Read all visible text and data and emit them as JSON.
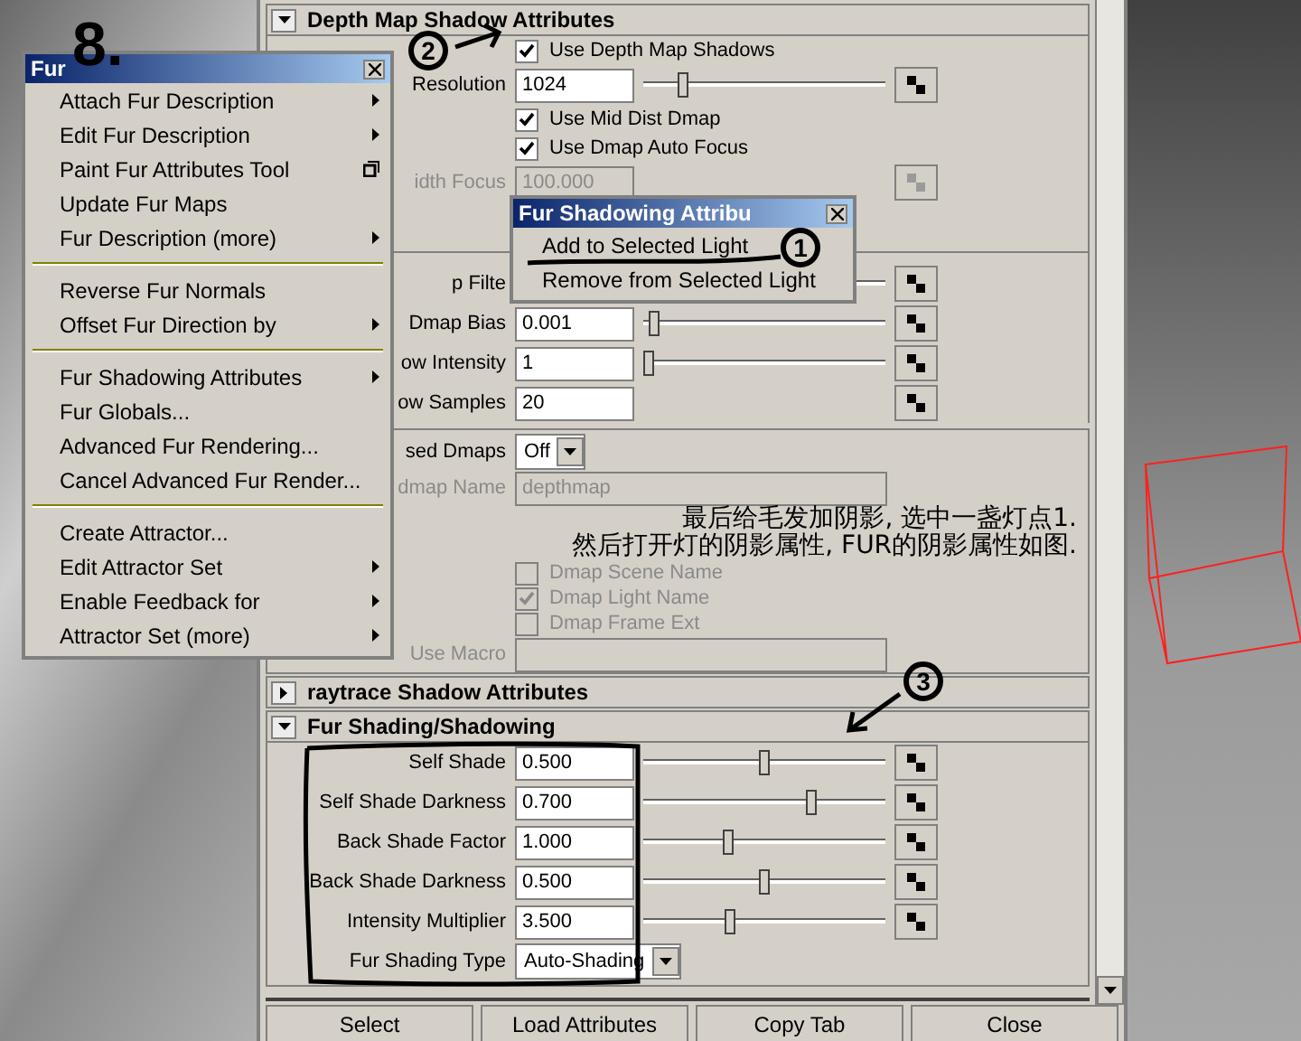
{
  "fur_menu": {
    "title": "Fur",
    "groups": [
      [
        {
          "label": "Attach Fur Description",
          "kind": "submenu"
        },
        {
          "label": "Edit Fur Description",
          "kind": "submenu"
        },
        {
          "label": "Paint Fur Attributes Tool",
          "kind": "option"
        },
        {
          "label": "Update Fur Maps",
          "kind": "plain"
        },
        {
          "label": "Fur Description (more)",
          "kind": "submenu"
        }
      ],
      [
        {
          "label": "Reverse Fur Normals",
          "kind": "plain"
        },
        {
          "label": "Offset Fur Direction by",
          "kind": "submenu"
        }
      ],
      [
        {
          "label": "Fur Shadowing Attributes",
          "kind": "submenu"
        },
        {
          "label": "Fur Globals...",
          "kind": "plain"
        },
        {
          "label": "Advanced Fur Rendering...",
          "kind": "plain"
        },
        {
          "label": "Cancel Advanced Fur Render...",
          "kind": "plain"
        }
      ],
      [
        {
          "label": "Create Attractor...",
          "kind": "plain"
        },
        {
          "label": "Edit Attractor Set",
          "kind": "submenu"
        },
        {
          "label": "Enable Feedback for",
          "kind": "submenu"
        },
        {
          "label": "Attractor Set (more)",
          "kind": "submenu"
        }
      ]
    ]
  },
  "submenu": {
    "title": "Fur Shadowing Attribu",
    "items": [
      "Add to Selected Light",
      "Remove from Selected Light"
    ]
  },
  "depth_section": {
    "title": "Depth Map Shadow Attributes",
    "expanded": true,
    "rows": [
      {
        "kind": "checkbox",
        "label": "Use Depth Map Shadows",
        "checked": true,
        "disabled": false
      },
      {
        "kind": "slider",
        "label": "Resolution",
        "value": "1024",
        "level": 0.15
      },
      {
        "kind": "checkbox",
        "label": "Use Mid Dist Dmap",
        "checked": true,
        "disabled": false
      },
      {
        "kind": "checkbox",
        "label": "Use Dmap Auto Focus",
        "checked": true,
        "disabled": false
      },
      {
        "kind": "field",
        "label": "idth Focus",
        "value": "100.000",
        "disabled": true
      },
      {
        "kind": "gap"
      },
      {
        "kind": "slider",
        "label": "p Filte"
      },
      {
        "kind": "slider",
        "label": "Dmap Bias",
        "value": "0.001",
        "level": 0.02
      },
      {
        "kind": "slider",
        "label": "ow Intensity",
        "value": "1",
        "level": 0.0
      },
      {
        "kind": "field",
        "label": "ow Samples",
        "value": "20"
      }
    ]
  },
  "dmap_section": {
    "rows": [
      {
        "kind": "dropdown",
        "label": "sed Dmaps",
        "value": "Off"
      },
      {
        "kind": "text",
        "label": "dmap Name",
        "value": "depthmap",
        "disabled": true
      },
      {
        "kind": "checkbox",
        "label": "Dmap Scene Name",
        "checked": false,
        "disabled": true
      },
      {
        "kind": "checkbox",
        "label": "Dmap Light Name",
        "checked": true,
        "disabled": true
      },
      {
        "kind": "checkbox",
        "label": "Dmap Frame Ext",
        "checked": false,
        "disabled": true
      },
      {
        "kind": "text",
        "label": "Use Macro",
        "disabled": true
      }
    ]
  },
  "raytrace_section": {
    "title": "raytrace Shadow Attributes",
    "expanded": false
  },
  "fur_section": {
    "title": "Fur Shading/Shadowing",
    "expanded": true,
    "rows": [
      {
        "kind": "slider",
        "label": "Self Shade",
        "value": "0.500",
        "level": 0.5
      },
      {
        "kind": "slider",
        "label": "Self Shade Darkness",
        "value": "0.700",
        "level": 0.7
      },
      {
        "kind": "slider",
        "label": "Back Shade Factor",
        "value": "1.000",
        "level": 0.34
      },
      {
        "kind": "slider",
        "label": "Back Shade Darkness",
        "value": "0.500",
        "level": 0.5
      },
      {
        "kind": "slider",
        "label": "Intensity Multiplier",
        "value": "3.500",
        "level": 0.35
      },
      {
        "kind": "dropdown",
        "label": "Fur Shading Type",
        "value": "Auto-Shading"
      }
    ]
  },
  "buttons": [
    "Select",
    "Load Attributes",
    "Copy Tab",
    "Close"
  ],
  "annotations": {
    "step_marks": [
      "8.",
      "2",
      "1",
      "3"
    ],
    "note_lines": [
      "最后给毛发加阴影, 选中一盏灯点1.",
      "然后打开灯的阴影属性, FUR的阴影属性如图."
    ]
  }
}
